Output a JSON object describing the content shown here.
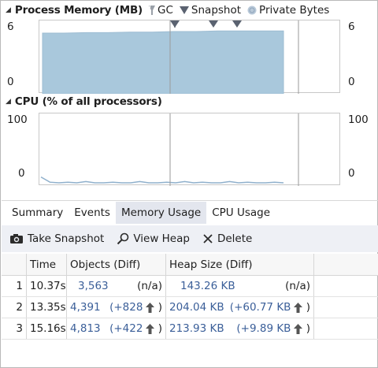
{
  "memory_section": {
    "title": "Process Memory (MB)",
    "legend": [
      {
        "label": "GC",
        "icon": "gc-icon"
      },
      {
        "label": "Snapshot",
        "icon": "snapshot-marker-icon"
      },
      {
        "label": "Private Bytes",
        "icon": "private-bytes-icon"
      }
    ],
    "y_max_label": "6",
    "y_min_label": "0",
    "fill_color": "#a9c8dc"
  },
  "cpu_section": {
    "title": "CPU (% of all processors)",
    "y_max_label": "100",
    "y_min_label": "0"
  },
  "chart_data": [
    {
      "type": "area",
      "title": "Process Memory (MB)",
      "ylim": [
        0,
        6
      ],
      "series": [
        {
          "name": "Private Bytes",
          "values": [
            5.7,
            5.7,
            5.75,
            5.75,
            5.8,
            5.8,
            5.85,
            5.85,
            5.9,
            5.9,
            5.9,
            5.9
          ]
        }
      ],
      "snapshots": 3,
      "gc_events": 1
    },
    {
      "type": "line",
      "title": "CPU (% of all processors)",
      "ylim": [
        0,
        100
      ],
      "series": [
        {
          "name": "CPU",
          "values": [
            9,
            1,
            0,
            1,
            0,
            2,
            0,
            0,
            1,
            0,
            0,
            2,
            0,
            0,
            1,
            0,
            2,
            0,
            1,
            0,
            0,
            2,
            0,
            1,
            0,
            0,
            1,
            0
          ]
        }
      ]
    }
  ],
  "tabs": [
    {
      "label": "Summary",
      "active": false
    },
    {
      "label": "Events",
      "active": false
    },
    {
      "label": "Memory Usage",
      "active": true
    },
    {
      "label": "CPU Usage",
      "active": false
    }
  ],
  "toolbar": {
    "take_snapshot": "Take Snapshot",
    "view_heap": "View Heap",
    "delete": "Delete"
  },
  "table": {
    "headers": {
      "time": "Time",
      "objects": "Objects (Diff)",
      "heap": "Heap Size (Diff)"
    },
    "rows": [
      {
        "index": "1",
        "time": "10.37s",
        "objects": "3,563",
        "objects_diff": "(n/a)",
        "objects_up": false,
        "heap": "143.26 KB",
        "heap_diff": "(n/a)",
        "heap_up": false
      },
      {
        "index": "2",
        "time": "13.35s",
        "objects": "4,391",
        "objects_diff": "(+828",
        "objects_up": true,
        "heap": "204.04 KB",
        "heap_diff": "(+60.77 KB",
        "heap_up": true
      },
      {
        "index": "3",
        "time": "15.16s",
        "objects": "4,813",
        "objects_diff": "(+422",
        "objects_up": true,
        "heap": "213.93 KB",
        "heap_diff": "(+9.89 KB",
        "heap_up": true
      }
    ]
  }
}
